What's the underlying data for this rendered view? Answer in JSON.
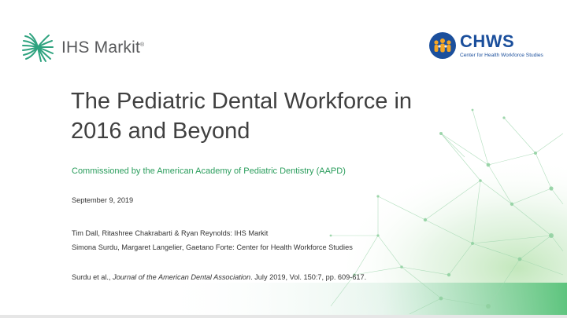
{
  "logos": {
    "left_brand": "IHS Markit",
    "left_brand_mark": "®",
    "right_brand": "CHWS",
    "right_brand_sub": "Center for Health Workforce Studies"
  },
  "slide": {
    "title_line1": "The Pediatric Dental Workforce in",
    "title_line2": "2016 and Beyond",
    "subtitle": "Commissioned by the American Academy of Pediatric Dentistry (AAPD)",
    "date": "September 9, 2019",
    "authors_ihs": "Tim Dall, Ritashree Chakrabarti & Ryan Reynolds: IHS Markit",
    "authors_chws": "Simona Surdu, Margaret Langelier, Gaetano Forte: Center for Health Workforce Studies",
    "citation_prefix": "Surdu et al., ",
    "citation_journal": "Journal of the American Dental Association",
    "citation_suffix": ". July 2019, Vol. 150:7, pp. 609-617."
  },
  "colors": {
    "title": "#404040",
    "subtitle": "#2a9d5c",
    "body_text": "#333333",
    "ihs_green": "#2fa37f",
    "chws_blue": "#1b4f9c",
    "chws_orange": "#f5a623",
    "network_green": "#bfe6c8"
  }
}
